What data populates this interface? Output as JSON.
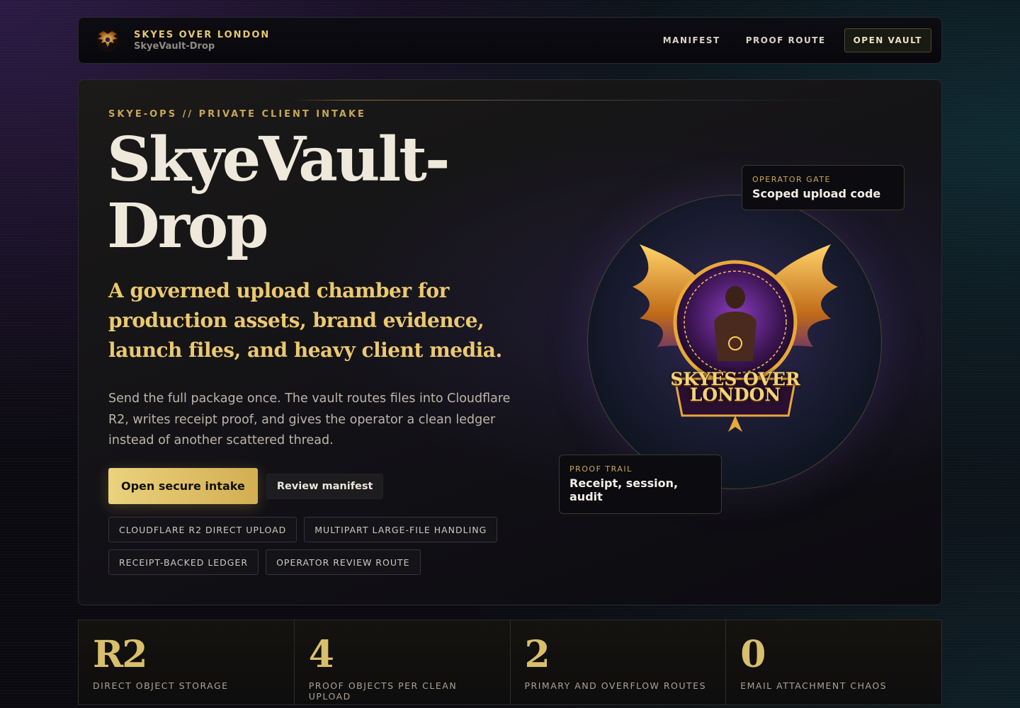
{
  "header": {
    "brand_title": "SKYES OVER LONDON",
    "brand_subtitle": "SkyeVault-Drop",
    "logo_icon": "winged-crest-icon",
    "nav": [
      {
        "label": "MANIFEST"
      },
      {
        "label": "PROOF ROUTE"
      }
    ],
    "cta_label": "OPEN VAULT"
  },
  "hero": {
    "eyebrow": "SKYE-OPS // PRIVATE CLIENT INTAKE",
    "title": "SkyeVault-Drop",
    "tagline": "A governed upload chamber for production assets, brand evidence, launch files, and heavy client media.",
    "description": "Send the full package once. The vault routes files into Cloudflare R2, writes receipt proof, and gives the operator a clean ledger instead of another scattered thread.",
    "primary_button": "Open secure intake",
    "secondary_button": "Review manifest",
    "tags": [
      "CLOUDFLARE R2 DIRECT UPLOAD",
      "MULTIPART LARGE-FILE HANDLING",
      "RECEIPT-BACKED LEDGER",
      "OPERATOR REVIEW ROUTE"
    ],
    "emblem_text": "SKYES OVER LONDON",
    "emblem_icon": "winged-crest-emblem-icon",
    "operator_gate": {
      "eyebrow": "OPERATOR GATE",
      "title": "Scoped upload code"
    },
    "proof_trail": {
      "eyebrow": "PROOF TRAIL",
      "title": "Receipt, session, audit"
    }
  },
  "stats": [
    {
      "value": "R2",
      "label": "DIRECT OBJECT STORAGE"
    },
    {
      "value": "4",
      "label": "PROOF OBJECTS PER CLEAN UPLOAD"
    },
    {
      "value": "2",
      "label": "PRIMARY AND OVERFLOW ROUTES"
    },
    {
      "value": "0",
      "label": "EMAIL ATTACHMENT CHAOS"
    }
  ],
  "colors": {
    "accent_gold": "#e6c66e",
    "background": "#0b0a10",
    "button_gold": "#ead27d"
  }
}
